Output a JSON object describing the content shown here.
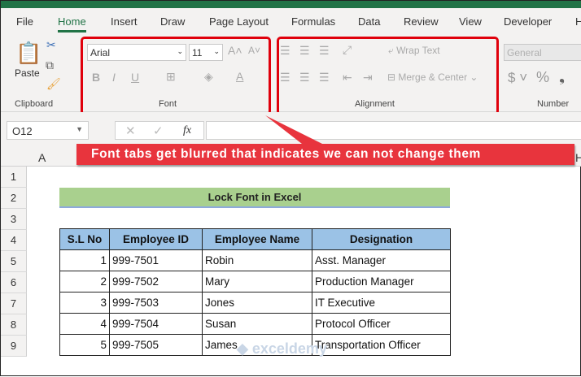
{
  "tabs": [
    "File",
    "Home",
    "Insert",
    "Draw",
    "Page Layout",
    "Formulas",
    "Data",
    "Review",
    "View",
    "Developer",
    "H"
  ],
  "ribbon": {
    "clipboard": {
      "paste": "Paste",
      "label": "Clipboard"
    },
    "font": {
      "name": "Arial",
      "size": "11",
      "label": "Font"
    },
    "alignment": {
      "wrap_text": "Wrap Text",
      "merge_center": "Merge & Center",
      "label": "Alignment"
    },
    "number": {
      "format": "General",
      "label": "Number",
      "currency": "$",
      "percent": "%",
      "comma": "❟"
    }
  },
  "formula_bar": {
    "name_box": "O12",
    "fx": "fx",
    "value": ""
  },
  "columns": [
    "A",
    "H"
  ],
  "rows": [
    "1",
    "2",
    "3",
    "4",
    "5",
    "6",
    "7",
    "8",
    "9"
  ],
  "callout": "Font tabs get blurred that indicates we can not change them",
  "sheet": {
    "title": "Lock Font in Excel",
    "headers": [
      "S.L No",
      "Employee ID",
      "Employee Name",
      "Designation"
    ],
    "rows": [
      [
        "1",
        "999-7501",
        "Robin",
        "Asst. Manager"
      ],
      [
        "2",
        "999-7502",
        "Mary",
        "Production Manager"
      ],
      [
        "3",
        "999-7503",
        "Jones",
        "IT Executive"
      ],
      [
        "4",
        "999-7504",
        "Susan",
        "Protocol Officer"
      ],
      [
        "5",
        "999-7505",
        "James",
        "Transportation Officer"
      ]
    ]
  },
  "watermark": "exceldemy EXCEL · DATA · BI",
  "colors": {
    "excel_green": "#217346",
    "highlight_red": "#e0000c",
    "title_fill": "#a9d08e",
    "header_fill": "#9bc2e6"
  }
}
